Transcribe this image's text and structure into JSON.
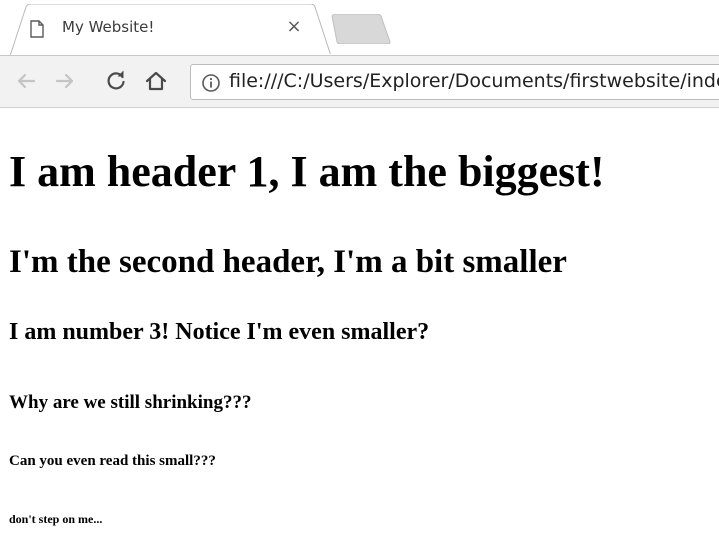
{
  "tab": {
    "title": "My Website!",
    "close": "×"
  },
  "toolbar": {
    "url": "file:///C:/Users/Explorer/Documents/firstwebsite/index.html"
  },
  "icons": {
    "favicon": "page-icon",
    "back": "arrow-left-icon",
    "forward": "arrow-right-icon",
    "reload": "reload-icon",
    "home": "home-icon",
    "info": "info-icon"
  },
  "page": {
    "h1": "I am header 1, I am the biggest!",
    "h2": "I'm the second header, I'm a bit smaller",
    "h3": "I am number 3! Notice I'm even smaller?",
    "h4": "Why are we still shrinking???",
    "h5": "Can you even read this small???",
    "h6": "don't step on me..."
  }
}
